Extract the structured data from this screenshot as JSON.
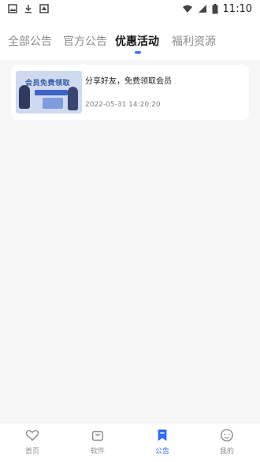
{
  "status_bar": {
    "time": "11:10",
    "icons": [
      "image-icon",
      "download-icon",
      "screenshot-icon",
      "wifi-icon",
      "signal-icon",
      "battery-icon"
    ]
  },
  "tabs": [
    {
      "label": "全部公告",
      "active": false
    },
    {
      "label": "官方公告",
      "active": false
    },
    {
      "label": "优惠活动",
      "active": true
    },
    {
      "label": "福利资源",
      "active": false
    }
  ],
  "notices": [
    {
      "image_text": "会员免费领取",
      "title": "分享好友，免费领取会员",
      "time": "2022-05-31 14:20:20"
    }
  ],
  "bottom_nav": [
    {
      "label": "首页",
      "icon": "heart-icon",
      "active": false
    },
    {
      "label": "软件",
      "icon": "bag-icon",
      "active": false
    },
    {
      "label": "公告",
      "icon": "bookmark-icon",
      "active": true
    },
    {
      "label": "我的",
      "icon": "smile-icon",
      "active": false
    }
  ],
  "colors": {
    "accent": "#2f6bf4",
    "background": "#f6f6f7",
    "inactive_text": "#8d8d8d"
  }
}
